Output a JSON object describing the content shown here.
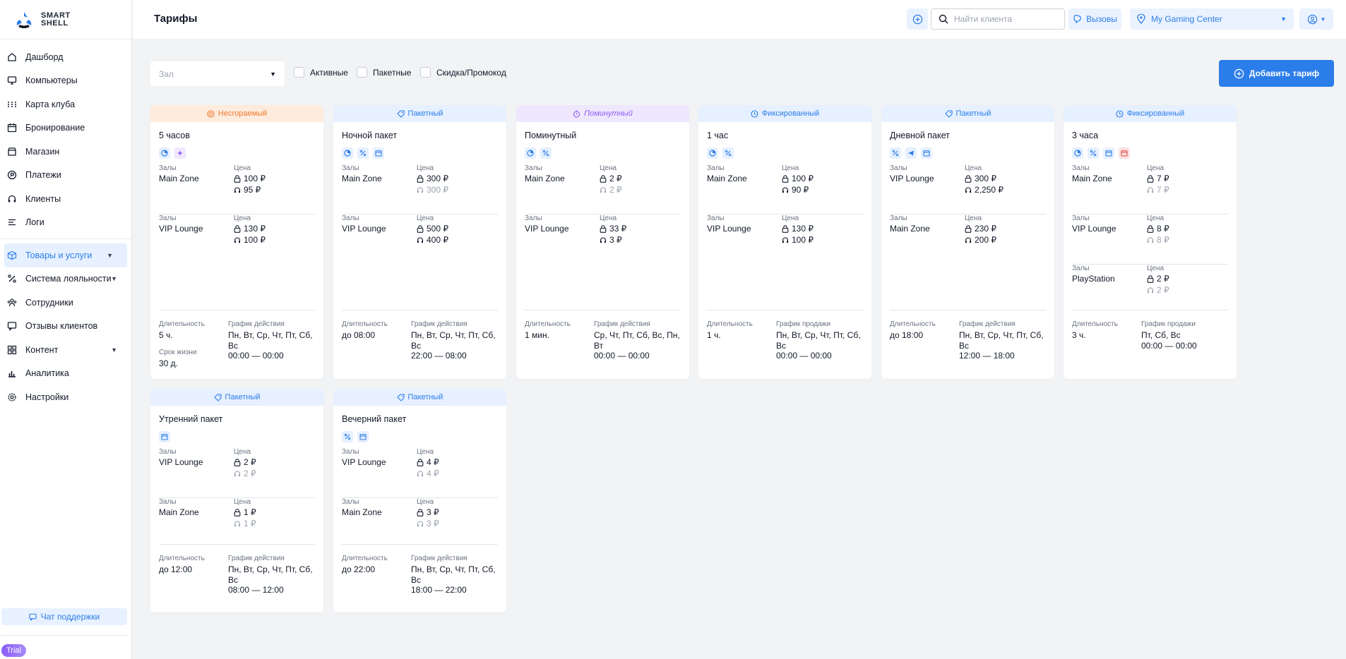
{
  "app": {
    "logo_line1": "SMART",
    "logo_line2": "SHELL",
    "page_title": "Тарифы"
  },
  "header": {
    "search_placeholder": "Найти клиента",
    "calls_label": "Вызовы",
    "location_label": "My Gaming Center"
  },
  "sidebar": {
    "items": [
      {
        "label": "Дашборд",
        "icon": "home-icon"
      },
      {
        "label": "Компьютеры",
        "icon": "monitor-icon"
      },
      {
        "label": "Карта клуба",
        "icon": "grid-dots-icon"
      },
      {
        "label": "Бронирование",
        "icon": "calendar-icon"
      },
      {
        "label": "Магазин",
        "icon": "store-icon"
      },
      {
        "label": "Платежи",
        "icon": "payment-icon"
      },
      {
        "label": "Клиенты",
        "icon": "headset-icon"
      },
      {
        "label": "Логи",
        "icon": "list-icon"
      }
    ],
    "items2": [
      {
        "label": "Товары и услуги",
        "icon": "cube-icon"
      },
      {
        "label": "Система лояльности",
        "icon": "percent-icon"
      },
      {
        "label": "Сотрудники",
        "icon": "users-icon"
      },
      {
        "label": "Отзывы клиентов",
        "icon": "chat-icon"
      },
      {
        "label": "Контент",
        "icon": "blocks-icon"
      },
      {
        "label": "Аналитика",
        "icon": "analytics-icon"
      },
      {
        "label": "Настройки",
        "icon": "gear-icon"
      }
    ],
    "support_label": "Чат поддержки",
    "trial_label": "Trial"
  },
  "filters": {
    "hall_placeholder": "Зал",
    "active_label": "Активные",
    "packet_label": "Пакетные",
    "discount_label": "Скидка/Промокод",
    "add_button": "Добавить тариф"
  },
  "labels": {
    "zones": "Залы",
    "price": "Цена",
    "duration": "Длительность",
    "schedule_action": "График действия",
    "schedule_sale": "График продажи",
    "lifetime": "Срок жизни"
  },
  "colors": {
    "accent": "#2b7de9",
    "burn": "#f07b2d",
    "minute": "#8b5cf6"
  },
  "cards": [
    {
      "type": "Несгораемый",
      "type_class": "type-burn",
      "name": "5 часов",
      "badges": [
        "clock-icon",
        "sparkle-icon"
      ],
      "zones": [
        {
          "zone": "Main Zone",
          "price1": "100 ₽",
          "price2": "95 ₽",
          "muted2": false
        },
        {
          "zone": "VIP Lounge",
          "price1": "130 ₽",
          "price2": "100 ₽",
          "muted2": false
        }
      ],
      "duration": "5 ч.",
      "schedule_label": "График действия",
      "schedule": [
        "Пн, Вт, Ср, Чт, Пт, Сб,",
        "Вс",
        "00:00 — 00:00"
      ],
      "lifetime": "30 д."
    },
    {
      "type": "Пакетный",
      "type_class": "type-packet",
      "name": "Ночной пакет",
      "badges": [
        "clock-icon",
        "percent-icon",
        "calendar-icon"
      ],
      "zones": [
        {
          "zone": "Main Zone",
          "price1": "300 ₽",
          "price2": "300 ₽",
          "muted2": true
        },
        {
          "zone": "VIP Lounge",
          "price1": "500 ₽",
          "price2": "400 ₽",
          "muted2": false
        }
      ],
      "duration": "до 08:00",
      "schedule_label": "График действия",
      "schedule": [
        "Пн, Вт, Ср, Чт, Пт, Сб,",
        "Вс",
        "22:00 — 08:00"
      ]
    },
    {
      "type": "Поминутный",
      "type_class": "type-minute",
      "name": "Поминутный",
      "badges": [
        "clock-icon",
        "percent-icon"
      ],
      "zones": [
        {
          "zone": "Main Zone",
          "price1": "2 ₽",
          "price2": "2 ₽",
          "muted2": true
        },
        {
          "zone": "VIP Lounge",
          "price1": "33 ₽",
          "price2": "3 ₽",
          "muted2": false
        }
      ],
      "duration": "1 мин.",
      "schedule_label": "График действия",
      "schedule": [
        "Ср, Чт, Пт, Сб, Вс, Пн,",
        "Вт",
        "00:00 — 00:00"
      ]
    },
    {
      "type": "Фиксированный",
      "type_class": "type-fixed",
      "name": "1 час",
      "badges": [
        "clock-icon",
        "percent-icon"
      ],
      "zones": [
        {
          "zone": "Main Zone",
          "price1": "100 ₽",
          "price2": "90 ₽",
          "muted2": false
        },
        {
          "zone": "VIP Lounge",
          "price1": "130 ₽",
          "price2": "100 ₽",
          "muted2": false
        }
      ],
      "duration": "1 ч.",
      "schedule_label": "График продажи",
      "schedule": [
        "Пн, Вт, Ср, Чт, Пт, Сб,",
        "Вс",
        "00:00 — 00:00"
      ]
    },
    {
      "type": "Пакетный",
      "type_class": "type-packet",
      "name": "Дневной пакет",
      "badges": [
        "percent-icon",
        "telegram-icon",
        "calendar-icon"
      ],
      "zones": [
        {
          "zone": "VIP Lounge",
          "price1": "300 ₽",
          "price2": "2,250 ₽",
          "muted2": false
        },
        {
          "zone": "Main Zone",
          "price1": "230 ₽",
          "price2": "200 ₽",
          "muted2": false
        }
      ],
      "duration": "до 18:00",
      "schedule_label": "График действия",
      "schedule": [
        "Пн, Вт, Ср, Чт, Пт, Сб,",
        "Вс",
        "12:00 — 18:00"
      ]
    },
    {
      "type": "Фиксированный",
      "type_class": "type-fixed",
      "name": "3 часа",
      "badges": [
        "clock-icon",
        "percent-icon",
        "calendar-icon",
        "calendar-red-icon"
      ],
      "zones": [
        {
          "zone": "Main Zone",
          "price1": "7 ₽",
          "price2": "7 ₽",
          "muted2": true
        },
        {
          "zone": "VIP Lounge",
          "price1": "8 ₽",
          "price2": "8 ₽",
          "muted2": true
        },
        {
          "zone": "PlayStation",
          "price1": "2 ₽",
          "price2": "2 ₽",
          "muted2": true
        }
      ],
      "duration": "3 ч.",
      "schedule_label": "График продажи",
      "schedule": [
        "Пт, Сб, Вс",
        "00:00 — 00:00"
      ]
    },
    {
      "type": "Пакетный",
      "type_class": "type-packet",
      "name": "Утренний пакет",
      "badges": [
        "calendar-icon"
      ],
      "zones": [
        {
          "zone": "VIP Lounge",
          "price1": "2 ₽",
          "price2": "2 ₽",
          "muted2": true
        },
        {
          "zone": "Main Zone",
          "price1": "1 ₽",
          "price2": "1 ₽",
          "muted2": true
        }
      ],
      "duration": "до 12:00",
      "schedule_label": "График действия",
      "schedule": [
        "Пн, Вт, Ср, Чт, Пт, Сб,",
        "Вс",
        "08:00 — 12:00"
      ]
    },
    {
      "type": "Пакетный",
      "type_class": "type-packet",
      "name": "Вечерний пакет",
      "badges": [
        "percent-icon",
        "calendar-icon"
      ],
      "zones": [
        {
          "zone": "VIP Lounge",
          "price1": "4 ₽",
          "price2": "4 ₽",
          "muted2": true
        },
        {
          "zone": "Main Zone",
          "price1": "3 ₽",
          "price2": "3 ₽",
          "muted2": true
        }
      ],
      "duration": "до 22:00",
      "schedule_label": "График действия",
      "schedule": [
        "Пн, Вт, Ср, Чт, Пт, Сб,",
        "Вс",
        "18:00 — 22:00"
      ]
    }
  ]
}
